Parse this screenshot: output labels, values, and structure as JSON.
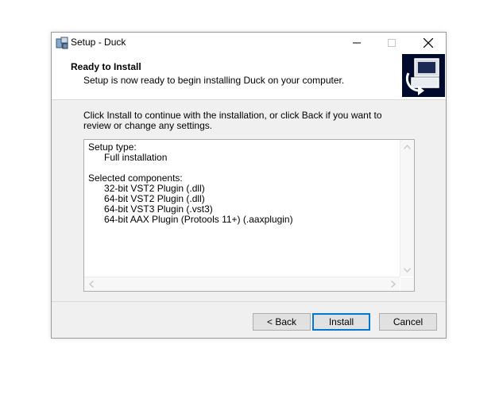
{
  "window": {
    "title": "Setup - Duck",
    "minimize_symbol": "—",
    "maximize_symbol": "☐",
    "close_symbol": "✕"
  },
  "header": {
    "title": "Ready to Install",
    "subtitle": "Setup is now ready to begin installing Duck on your computer."
  },
  "main": {
    "instruction": "Click Install to continue with the installation, or click Back if you want to review or change any settings.",
    "memo": {
      "setup_type_label": "Setup type:",
      "setup_type_value": "Full installation",
      "components_label": "Selected components:",
      "components": [
        "32-bit VST2 Plugin (.dll)",
        "64-bit VST2 Plugin (.dll)",
        "64-bit VST3 Plugin (.vst3)",
        "64-bit AAX Plugin (Protools 11+) (.aaxplugin)"
      ]
    }
  },
  "buttons": {
    "back": "< Back",
    "install": "Install",
    "cancel": "Cancel"
  },
  "icons": {
    "app": "installer-icon",
    "wizard": "computer-install-icon"
  },
  "colors": {
    "focus_border": "#0078d7",
    "wizard_bg": "#000a2c"
  }
}
